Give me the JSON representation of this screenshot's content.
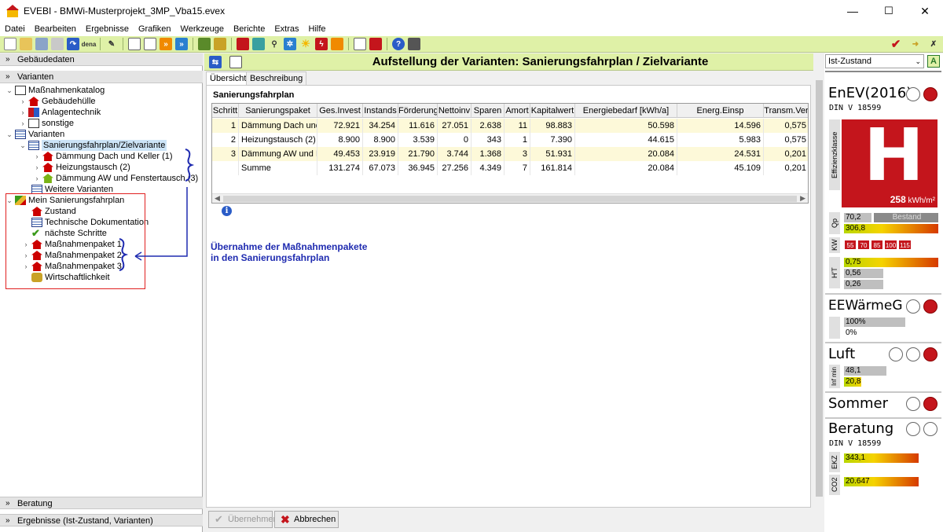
{
  "window": {
    "title": "EVEBI - BMWi-Musterprojekt_3MP_Vba15.evex",
    "min": "—",
    "max": "☐",
    "close": "✕"
  },
  "menu": [
    "Datei",
    "Bearbeiten",
    "Ergebnisse",
    "Grafiken",
    "Werkzeuge",
    "Berichte",
    "Extras",
    "Hilfe"
  ],
  "left": {
    "gebaeudedaten": "Gebäudedaten",
    "varianten": "Varianten",
    "tree": {
      "katalog": "Maßnahmenkatalog",
      "huelle": "Gebäudehülle",
      "anlage": "Anlagentechnik",
      "sonstige": "sonstige",
      "varianten": "Varianten",
      "sfp": "Sanierungsfahrplan/Zielvariante",
      "v1": "Dämmung Dach und Keller (1)",
      "v2": "Heizungstausch (2)",
      "v3": "Dämmung AW und Fenstertausch (3)",
      "weitere": "Weitere Varianten",
      "mein": "Mein Sanierungsfahrplan",
      "zustand": "Zustand",
      "techdoc": "Technische Dokumentation",
      "naechste": "nächste Schritte",
      "p1": "Maßnahmenpaket 1",
      "p2": "Maßnahmenpaket 2",
      "p3": "Maßnahmenpaket 3",
      "wirt": "Wirtschaftlichkeit"
    },
    "beratung": "Beratung",
    "ergebnisse": "Ergebnisse (Ist-Zustand, Varianten)"
  },
  "main": {
    "title": "Aufstellung der Varianten: Sanierungsfahrplan / Zielvariante",
    "tabs": [
      "Übersicht",
      "Beschreibung"
    ],
    "grid_title": "Sanierungsfahrplan",
    "columns": [
      "Schritt",
      "Sanierungspaket",
      "Ges.Invest",
      "Instands",
      "Förderung",
      "Nettoinv",
      "Sparen",
      "Amort",
      "Kapitalwert",
      "Energiebedarf [kWh/a]",
      "Energ.Einsp",
      "Transm.Ver"
    ],
    "rows": [
      [
        "1",
        "Dämmung Dach und ...",
        "72.921",
        "34.254",
        "11.616",
        "27.051",
        "2.638",
        "11",
        "98.883",
        "50.598",
        "14.596",
        "0,575"
      ],
      [
        "2",
        "Heizungstausch (2)",
        "8.900",
        "8.900",
        "3.539",
        "0",
        "343",
        "1",
        "7.390",
        "44.615",
        "5.983",
        "0,575"
      ],
      [
        "3",
        "Dämmung AW und F...",
        "49.453",
        "23.919",
        "21.790",
        "3.744",
        "1.368",
        "3",
        "51.931",
        "20.084",
        "24.531",
        "0,201"
      ],
      [
        "",
        "Summe",
        "131.274",
        "67.073",
        "36.945",
        "27.256",
        "4.349",
        "7",
        "161.814",
        "20.084",
        "45.109",
        "0,201"
      ]
    ],
    "annotation_line1": "Übernahme der Maßnahmenpakete",
    "annotation_line2": "in den Sanierungsfahrplan",
    "btn_accept": "Übernehmen",
    "btn_cancel": "Abbrechen"
  },
  "right": {
    "select": "Ist-Zustand",
    "enev": "EnEV(2016)",
    "din1": "DIN V 18599",
    "effclass_label": "Effizienzklasse",
    "effclass": "H",
    "effvalue": "258",
    "effunit": "kWh/m²",
    "qp_label": "Qp",
    "qp_val1": "70,2",
    "qp_bestand": "Bestand",
    "qp_val2": "306,8",
    "kw_label": "KW",
    "kw_vals": [
      "55",
      "70",
      "85",
      "100",
      "115"
    ],
    "ht_label": "H'T",
    "ht_vals": [
      "0,75",
      "0,56",
      "0,26"
    ],
    "eew": "EEWärmeG",
    "eew_vals": [
      "100%",
      "0%"
    ],
    "luft": "Luft",
    "luft_label": "Inf min",
    "luft_vals": [
      "48,1",
      "20,8"
    ],
    "sommer": "Sommer",
    "beratung": "Beratung",
    "din2": "DIN V 18599",
    "ekz_label": "EKZ",
    "ekz": "343,1",
    "co2_label": "CO2",
    "co2": "20.647"
  },
  "colors": {
    "toolbar": "#dff1a7",
    "red": "#c4151c",
    "annot": "#1f2bb0"
  }
}
